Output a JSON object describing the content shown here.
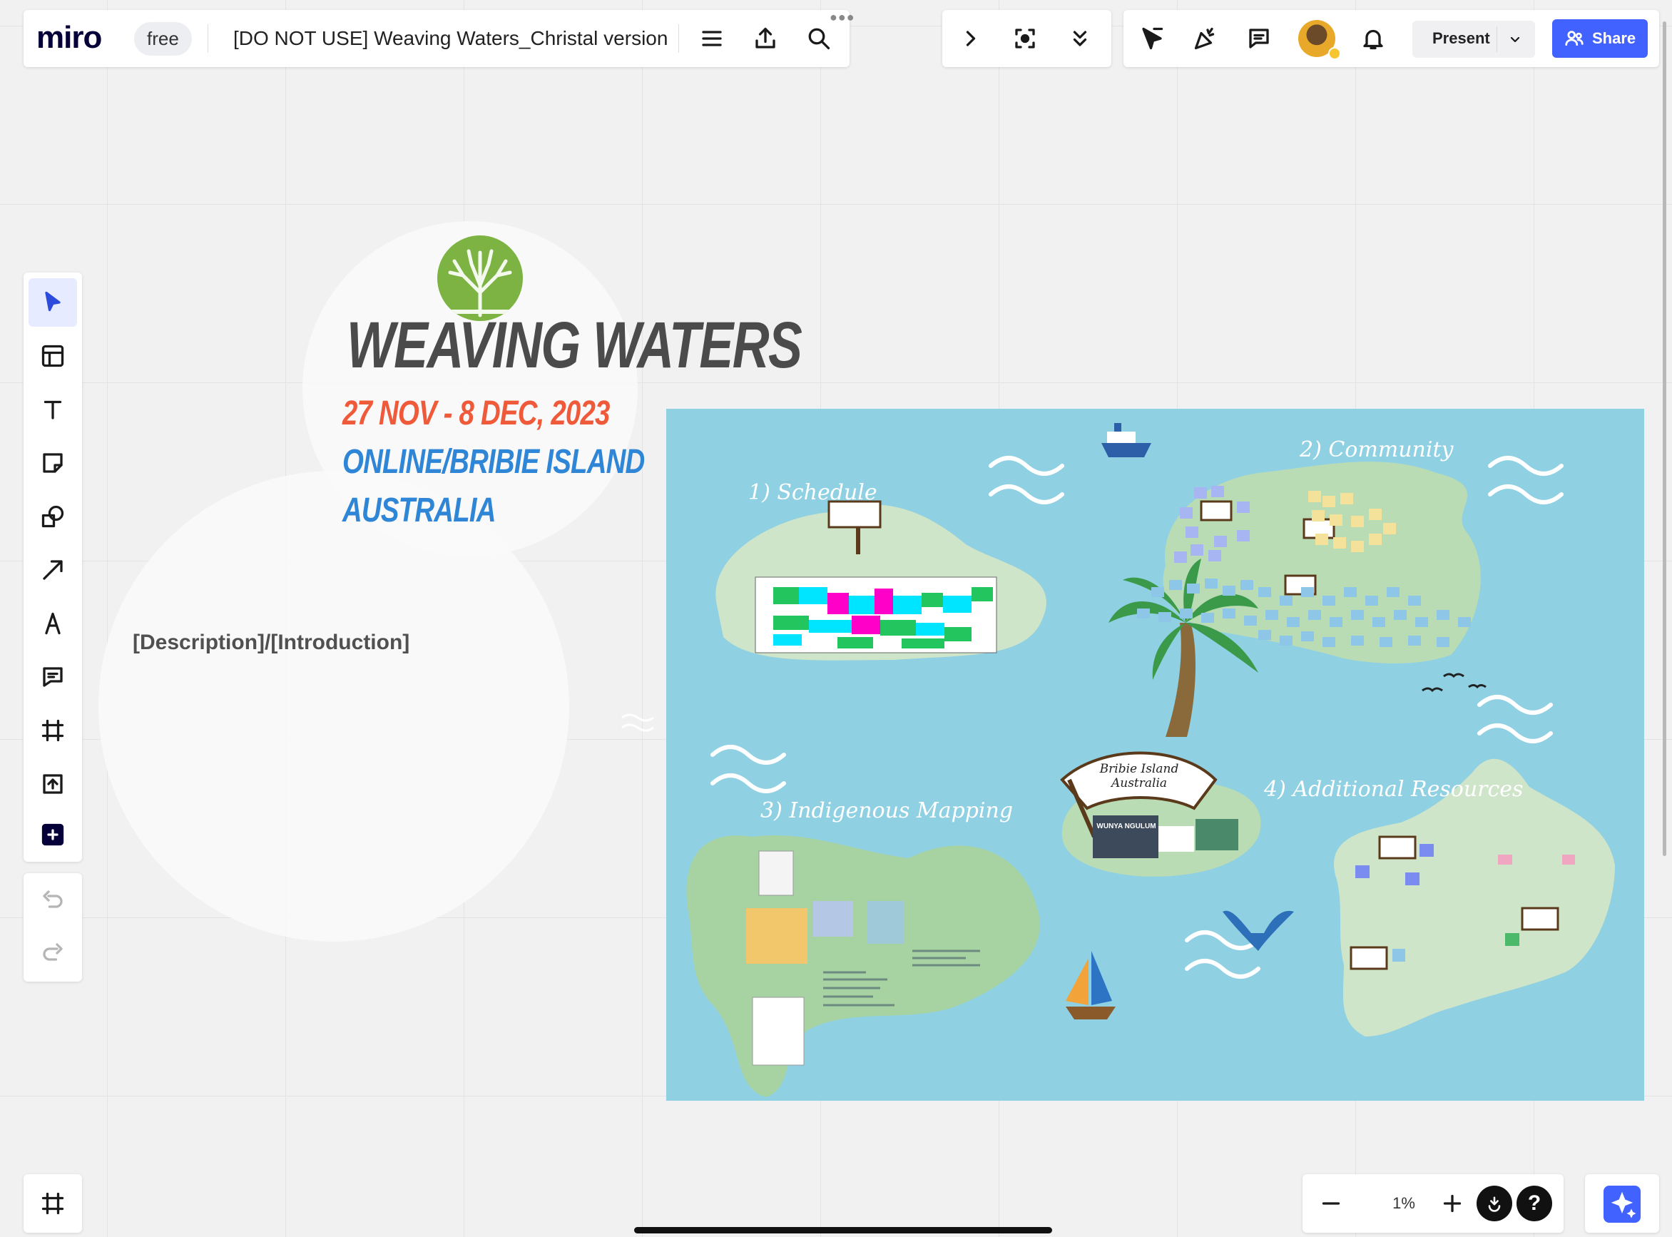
{
  "app": {
    "logo": "miro",
    "plan_badge": "free"
  },
  "board": {
    "title": "[DO NOT USE] Weaving Waters_Christal version"
  },
  "topbar": {
    "present_label": "Present",
    "share_label": "Share"
  },
  "zoom": {
    "level": "1%"
  },
  "content": {
    "title": "WEAVING WATERS",
    "dates": "27 NOV - 8 DEC, 2023",
    "location": "ONLINE/BRIBIE ISLAND",
    "country": "AUSTRALIA",
    "description": "[Description]/[Introduction]"
  },
  "map": {
    "schedule_label": "1) Schedule",
    "community_label": "2) Community",
    "indigenous_label": "3) Indigenous Mapping",
    "resources_label": "4) Additional Resources",
    "center_sign": "Bribie Island Australia",
    "center_box": "WUNYA NGULUM"
  },
  "colors": {
    "accent": "#4262ff",
    "date_orange": "#ef5b3a",
    "location_blue": "#2f86d6",
    "sea": "#8fd0e2",
    "island": "#cfe5c9"
  },
  "icons": [
    "menu-icon",
    "export-icon",
    "search-icon",
    "chevron-right-icon",
    "focus-icon",
    "chevrons-down-icon",
    "cursor-flag-icon",
    "celebrate-icon",
    "comments-icon",
    "bell-icon",
    "chevron-down-icon",
    "share-users-icon",
    "select-icon",
    "templates-icon",
    "text-icon",
    "sticky-note-icon",
    "shapes-icon",
    "arrow-icon",
    "pen-icon",
    "comment-icon",
    "frame-icon",
    "upload-icon",
    "plus-icon",
    "undo-icon",
    "redo-icon",
    "frames-list-icon",
    "minus-icon",
    "plus-zoom-icon",
    "reactions-icon",
    "help-icon",
    "ai-sparkle-icon"
  ]
}
